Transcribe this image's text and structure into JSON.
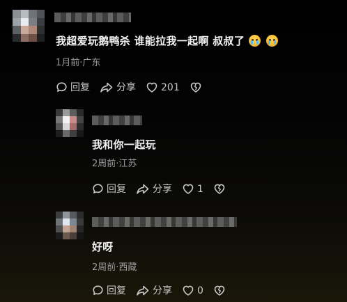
{
  "comments": [
    {
      "text": "我超爱玩鹅鸭杀 谁能拉我一起啊 叔叔了",
      "emoji_names": [
        "crying-face-emoji",
        "crying-face-emoji"
      ],
      "meta": "1月前·广东",
      "reply_label": "回复",
      "share_label": "分享",
      "like_count": "201"
    },
    {
      "text": "我和你一起玩",
      "meta": "2周前·江苏",
      "reply_label": "回复",
      "share_label": "分享",
      "like_count": "1"
    },
    {
      "text": "好呀",
      "meta": "2周前·西藏",
      "reply_label": "回复",
      "share_label": "分享",
      "like_count": "0"
    }
  ],
  "icons": {
    "reply": "reply-bubble-icon",
    "share": "share-arrow-icon",
    "like": "heart-icon",
    "dislike": "broken-heart-icon"
  },
  "colors": {
    "text": "#f2f2f2",
    "meta": "#9a9a9a",
    "action": "#c8c8c8"
  }
}
